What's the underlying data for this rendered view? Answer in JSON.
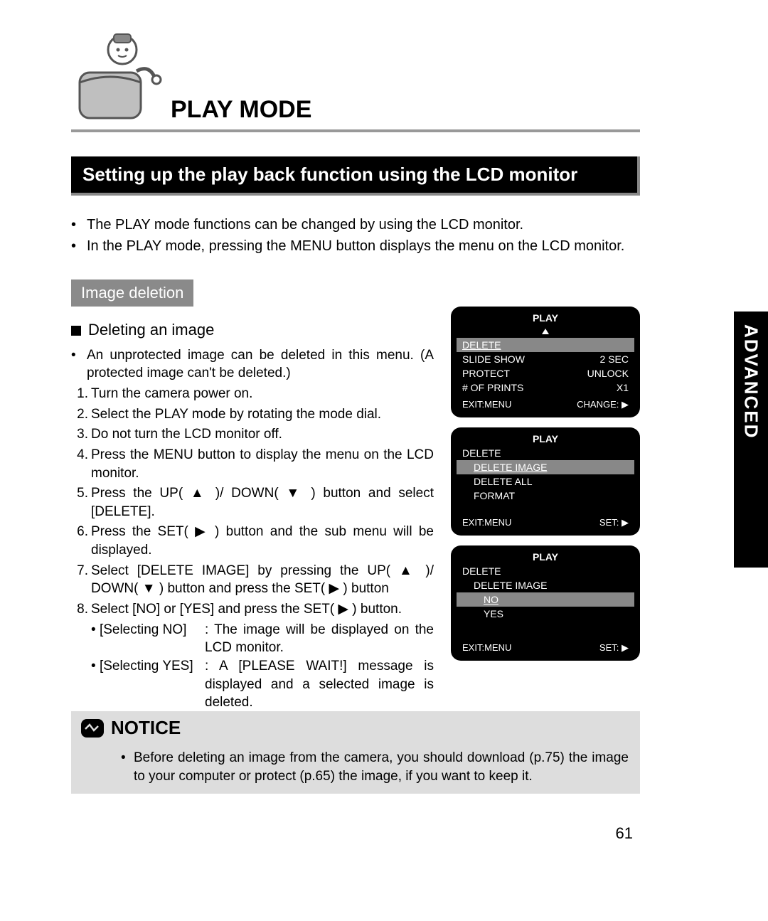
{
  "header": {
    "title": "PLAY MODE"
  },
  "subtitle": "Setting up the play back function using the LCD monitor",
  "intro": [
    "The PLAY mode functions can be changed by using the LCD monitor.",
    "In the PLAY mode, pressing the MENU button displays the menu on the LCD monitor."
  ],
  "section_tag": "Image deletion",
  "sub_heading": "Deleting an image",
  "body_intro": "An unprotected image can be deleted in this menu. (A protected image can't be deleted.)",
  "steps": [
    "Turn the camera power on.",
    "Select the PLAY mode by rotating the mode dial.",
    "Do not turn the LCD monitor off.",
    "Press the MENU button to display the menu on the LCD monitor.",
    "Press the UP( ▲ )/ DOWN( ▼ ) button and select [DELETE].",
    "Press the SET( ▶ ) button and the sub menu will be displayed.",
    "Select [DELETE IMAGE] by pressing the UP( ▲ )/ DOWN( ▼ ) button and press the SET( ▶ ) button",
    "Select [NO] or [YES] and press the SET( ▶ ) button."
  ],
  "selecting": {
    "no_label": "[Selecting NO]",
    "no_text": ": The image will be displayed on the LCD monitor.",
    "yes_label": "[Selecting YES]",
    "yes_text": ": A [PLEASE WAIT!] message is displayed and a selected image is deleted."
  },
  "screens": {
    "s1": {
      "title": "PLAY",
      "rows": [
        {
          "l": "DELETE",
          "r": ""
        },
        {
          "l": "SLIDE SHOW",
          "r": "2 SEC"
        },
        {
          "l": "PROTECT",
          "r": "UNLOCK"
        },
        {
          "l": "# OF PRINTS",
          "r": "X1"
        }
      ],
      "foot_l": "EXIT:MENU",
      "foot_r": "CHANGE: ▶"
    },
    "s2": {
      "title": "PLAY",
      "top": "DELETE",
      "rows": [
        "DELETE IMAGE",
        "DELETE ALL",
        "FORMAT"
      ],
      "foot_l": "EXIT:MENU",
      "foot_r": "SET: ▶"
    },
    "s3": {
      "title": "PLAY",
      "top": "DELETE",
      "mid": "DELETE IMAGE",
      "rows": [
        "NO",
        "YES"
      ],
      "foot_l": "EXIT:MENU",
      "foot_r": "SET: ▶"
    }
  },
  "notice": {
    "label": "NOTICE",
    "text": "Before deleting an image from the camera, you should download (p.75) the image to your computer or protect (p.65) the image, if you want to keep it."
  },
  "side_tab": "ADVANCED",
  "page_number": "61"
}
